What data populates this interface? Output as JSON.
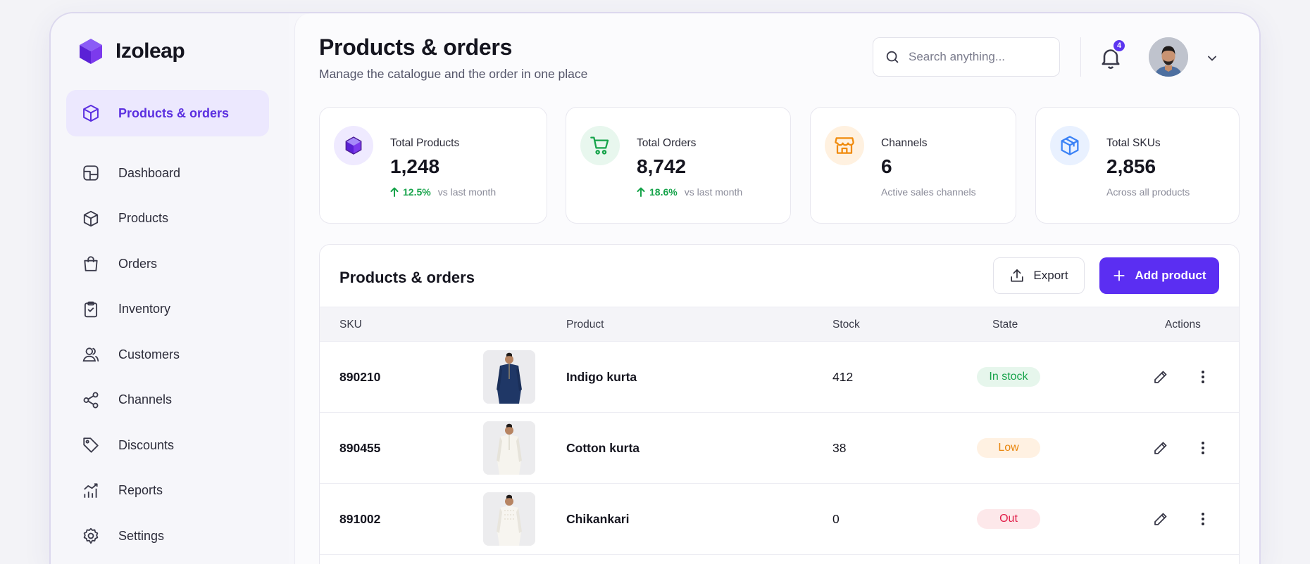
{
  "app": {
    "name": "Izoleap"
  },
  "sidebar": {
    "active": {
      "label": "Products & orders",
      "icon": "cube-icon"
    },
    "items": [
      {
        "label": "Dashboard",
        "icon": "dashboard-icon"
      },
      {
        "label": "Products",
        "icon": "cube-icon"
      },
      {
        "label": "Orders",
        "icon": "shopping-bag-icon"
      },
      {
        "label": "Inventory",
        "icon": "clipboard-icon"
      },
      {
        "label": "Customers",
        "icon": "users-icon"
      },
      {
        "label": "Channels",
        "icon": "share-icon"
      },
      {
        "label": "Discounts",
        "icon": "tag-icon"
      },
      {
        "label": "Reports",
        "icon": "chart-icon"
      },
      {
        "label": "Settings",
        "icon": "gear-icon"
      }
    ]
  },
  "header": {
    "title": "Products & orders",
    "subtitle": "Manage the catalogue and the order in one place",
    "search_placeholder": "Search anything...",
    "notification_count": "4"
  },
  "stats": [
    {
      "title": "Total Products",
      "value": "1,248",
      "change": "12.5%",
      "change_note": "vs last month",
      "icon": "cube-icon",
      "color": "#6d3df0",
      "bg": "#efeaff"
    },
    {
      "title": "Total Orders",
      "value": "8,742",
      "change": "18.6%",
      "change_note": "vs last month",
      "icon": "cart-icon",
      "color": "#16a34a",
      "bg": "#e8f7ee"
    },
    {
      "title": "Channels",
      "value": "6",
      "note": "Active sales channels",
      "icon": "store-icon",
      "color": "#f08a0c",
      "bg": "#fff1e0"
    },
    {
      "title": "Total SKUs",
      "value": "2,856",
      "note": "Across all products",
      "icon": "box-icon",
      "color": "#3b82f6",
      "bg": "#e9f1ff"
    }
  ],
  "table": {
    "title": "Products & orders",
    "export_label": "Export",
    "add_label": "Add product",
    "columns": {
      "sku": "SKU",
      "product": "Product",
      "stock": "Stock",
      "state": "State",
      "actions": "Actions"
    },
    "rows": [
      {
        "sku": "890210",
        "product": "Indigo kurta",
        "stock": "412",
        "state": "In stock",
        "state_color": "green",
        "kurta_color": "#1f3766"
      },
      {
        "sku": "890455",
        "product": "Cotton kurta",
        "stock": "38",
        "state": "Low",
        "state_color": "orange",
        "kurta_color": "#f1efe8"
      },
      {
        "sku": "891002",
        "product": "Chikankari",
        "stock": "0",
        "state": "Out",
        "state_color": "red",
        "kurta_color": "#f3f1ec"
      }
    ]
  }
}
